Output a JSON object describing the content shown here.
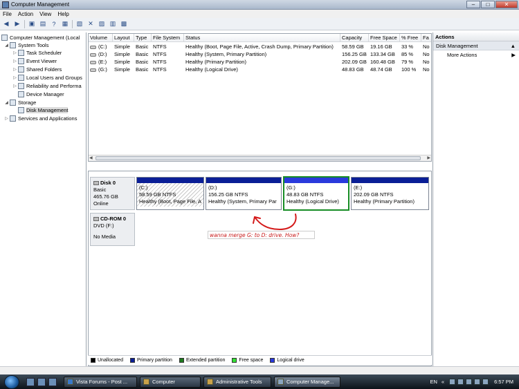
{
  "window": {
    "title": "Computer Management",
    "controls": [
      "–",
      "□",
      "✕"
    ]
  },
  "menu": [
    "File",
    "Action",
    "View",
    "Help"
  ],
  "toolbar": [
    "back-icon",
    "forward-icon",
    "up-folder-icon",
    "show-tree-icon",
    "help-icon",
    "properties-icon",
    "delete-icon",
    "export-icon",
    "folder-icon",
    "disk-icon",
    "refresh-icon"
  ],
  "tree": [
    {
      "label": "Computer Management (Local",
      "indent": 0,
      "exp": ""
    },
    {
      "label": "System Tools",
      "indent": 1,
      "exp": "◢"
    },
    {
      "label": "Task Scheduler",
      "indent": 2,
      "exp": "▷"
    },
    {
      "label": "Event Viewer",
      "indent": 2,
      "exp": "▷"
    },
    {
      "label": "Shared Folders",
      "indent": 2,
      "exp": "▷"
    },
    {
      "label": "Local Users and Groups",
      "indent": 2,
      "exp": "▷"
    },
    {
      "label": "Reliability and Performa",
      "indent": 2,
      "exp": "▷"
    },
    {
      "label": "Device Manager",
      "indent": 2,
      "exp": ""
    },
    {
      "label": "Storage",
      "indent": 1,
      "exp": "◢"
    },
    {
      "label": "Disk Management",
      "indent": 2,
      "exp": "",
      "selected": true
    },
    {
      "label": "Services and Applications",
      "indent": 1,
      "exp": "▷"
    }
  ],
  "volumes": {
    "columns": [
      "Volume",
      "Layout",
      "Type",
      "File System",
      "Status",
      "Capacity",
      "Free Space",
      "% Free",
      "Fa"
    ],
    "rows": [
      [
        "(C:)",
        "Simple",
        "Basic",
        "NTFS",
        "Healthy (Boot, Page File, Active, Crash Dump, Primary Partition)",
        "58.59 GB",
        "19.16 GB",
        "33 %",
        "No"
      ],
      [
        "(D:)",
        "Simple",
        "Basic",
        "NTFS",
        "Healthy (System, Primary Partition)",
        "156.25 GB",
        "133.34 GB",
        "85 %",
        "No"
      ],
      [
        "(E:)",
        "Simple",
        "Basic",
        "NTFS",
        "Healthy (Primary Partition)",
        "202.09 GB",
        "160.48 GB",
        "79 %",
        "No"
      ],
      [
        "(G:)",
        "Simple",
        "Basic",
        "NTFS",
        "Healthy (Logical Drive)",
        "48.83 GB",
        "48.74 GB",
        "100 %",
        "No"
      ]
    ]
  },
  "disk0": {
    "name": "Disk 0",
    "type": "Basic",
    "size": "465.76 GB",
    "state": "Online",
    "partitions": [
      {
        "label": "(C:)",
        "size": "58.59 GB NTFS",
        "status": "Healthy (Boot, Page File, A"
      },
      {
        "label": "(D:)",
        "size": "156.25 GB NTFS",
        "status": "Healthy (System, Primary Par"
      },
      {
        "label": "(G:)",
        "size": "48.83 GB NTFS",
        "status": "Healthy (Logical Drive)"
      },
      {
        "label": "(E:)",
        "size": "202.09 GB NTFS",
        "status": "Healthy (Primary Partition)"
      }
    ]
  },
  "cdrom": {
    "name": "CD-ROM 0",
    "type": "DVD (F:)",
    "media": "No Media"
  },
  "annotation": "wanna merge G: to D: drive. How?",
  "legend": [
    {
      "label": "Unallocated",
      "color": "#000000"
    },
    {
      "label": "Primary partition",
      "color": "#0a1e96"
    },
    {
      "label": "Extended partition",
      "color": "#1e7a1e"
    },
    {
      "label": "Free space",
      "color": "#33e033"
    },
    {
      "label": "Logical drive",
      "color": "#2a3adc"
    }
  ],
  "actions": {
    "header": "Actions",
    "section": "Disk Management",
    "item": "More Actions"
  },
  "taskbar": {
    "tasks": [
      "Vista Forums - Post ...",
      "Computer",
      "Administrative Tools",
      "Computer Manage..."
    ],
    "lang": "EN",
    "time": "6:57 PM"
  }
}
